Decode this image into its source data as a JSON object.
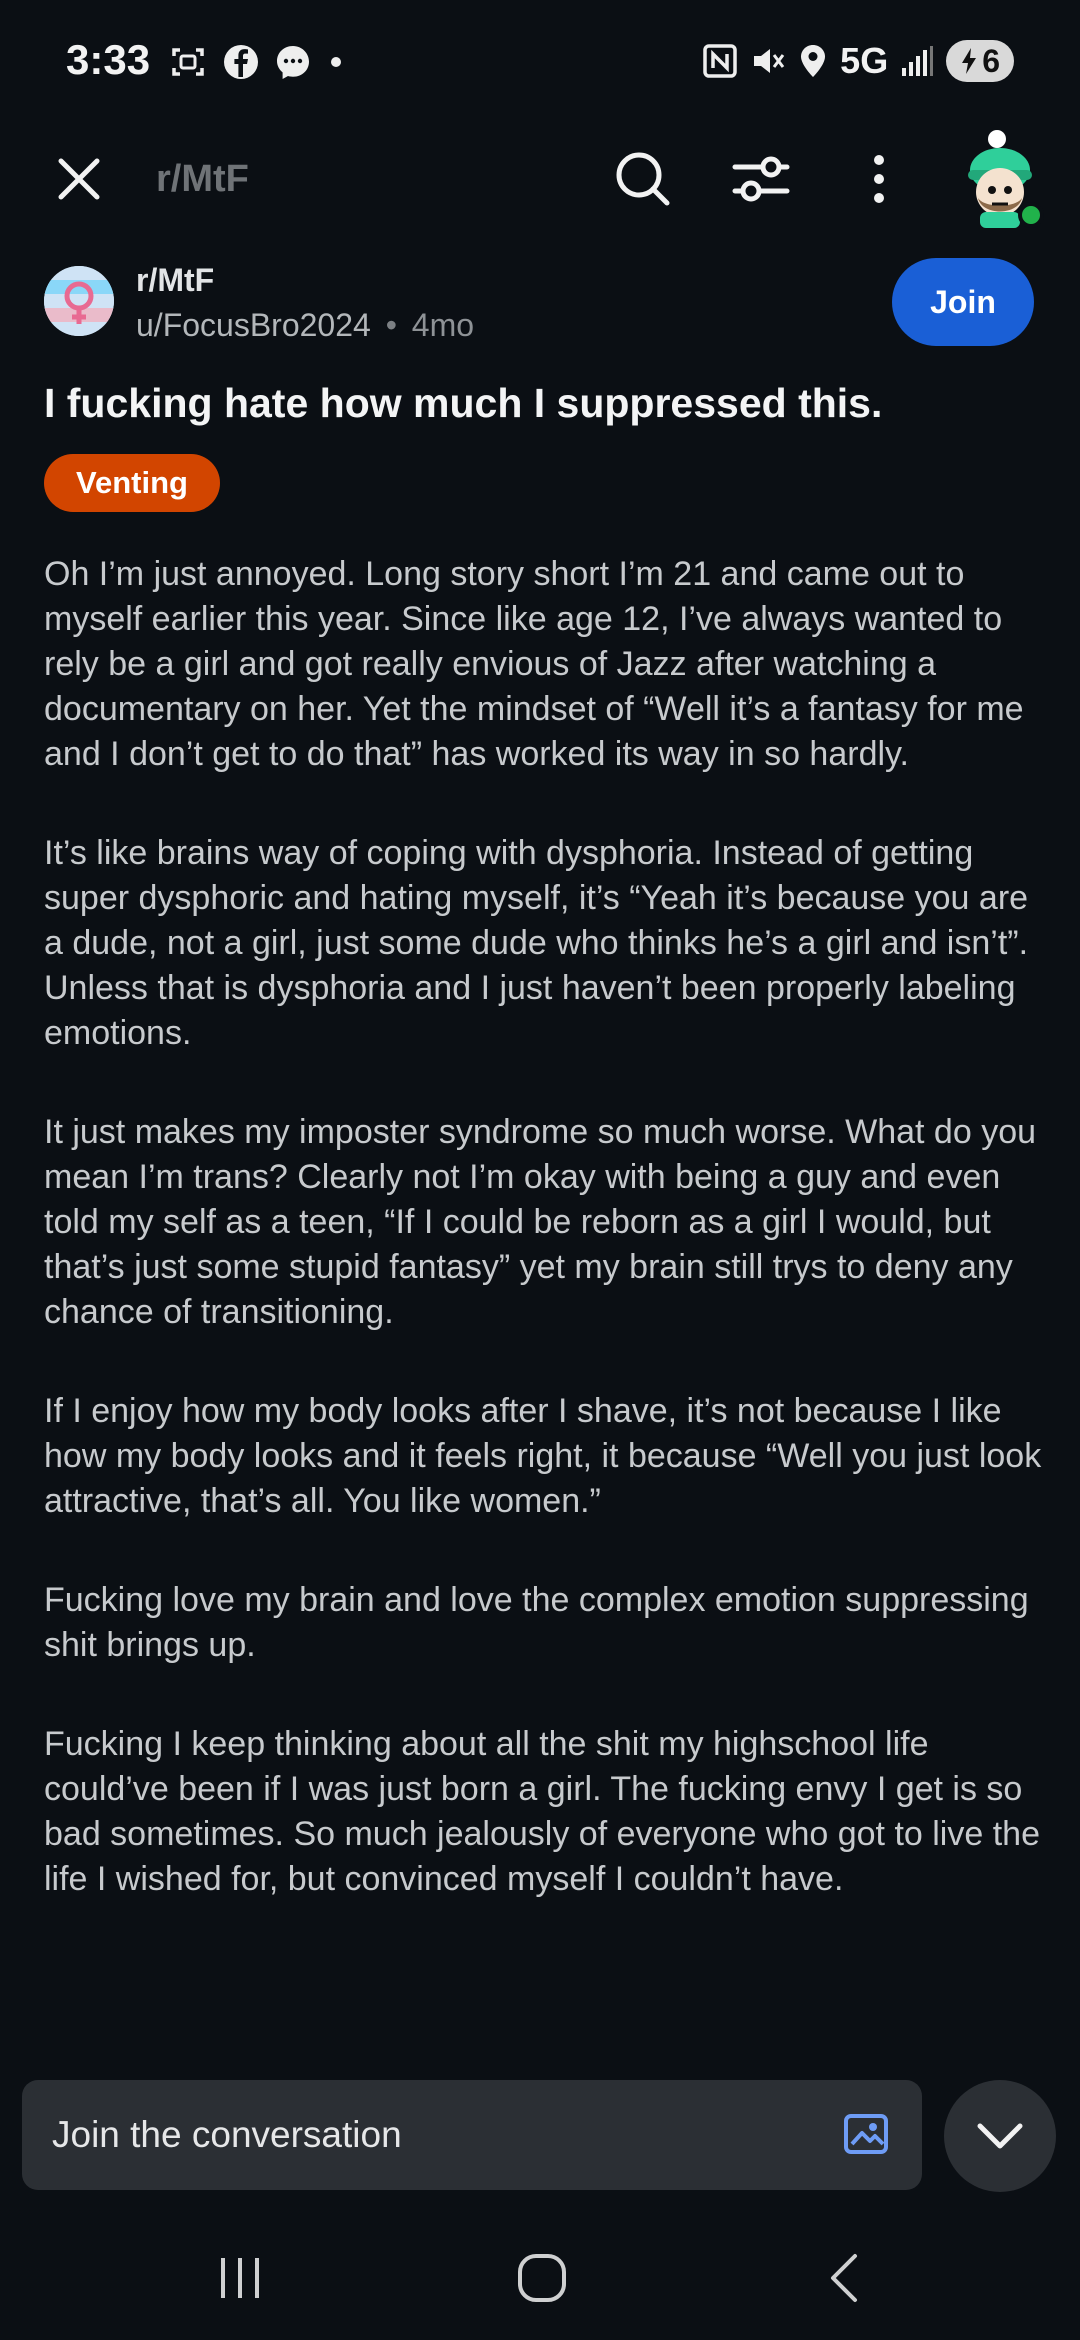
{
  "status_bar": {
    "time": "3:33",
    "network": "5G",
    "battery": "6",
    "icons": [
      "screenshot-icon",
      "facebook-icon",
      "messenger-icon",
      "dot-icon",
      "nfc-icon",
      "mute-icon",
      "location-icon",
      "signal-icon",
      "battery-charging-icon"
    ]
  },
  "nav": {
    "title": "r/MtF",
    "icons": [
      "close-icon",
      "search-icon",
      "filter-icon",
      "more-icon",
      "avatar"
    ]
  },
  "post": {
    "subreddit": "r/MtF",
    "author": "u/FocusBro2024",
    "separator": "•",
    "age": "4mo",
    "join_label": "Join",
    "title": "I fucking hate how much I suppressed this.",
    "flair": "Venting",
    "flair_color": "#d24500",
    "body": [
      "Oh I’m just annoyed. Long story short I’m 21 and came out to myself earlier this year. Since like age 12, I’ve always wanted to rely be a girl and got really envious of Jazz after watching a documentary on her. Yet the mindset of “Well it’s a fantasy for me and I don’t get to do that” has worked its way in so hardly.",
      "It’s like brains way of coping with dysphoria. Instead of getting super dysphoric and hating myself, it’s “Yeah it’s because you are a dude, not a girl, just some dude who thinks he’s a girl and isn’t”. Unless that is dysphoria and I just haven’t been properly labeling emotions.",
      "It just makes my imposter syndrome so much worse. What do you mean I’m trans? Clearly not I’m okay with being a guy and even told my self as a teen, “If I could be reborn as a girl I would, but that’s just some stupid fantasy” yet my brain still trys to deny any chance of transitioning.",
      "If I enjoy how my body looks after I shave, it’s not because I like how my body looks and it feels right, it because “Well you just look attractive, that’s all. You like women.”",
      "Fucking love my brain and love the complex emotion suppressing shit brings up.",
      "Fucking I keep thinking about all the shit my highschool life could’ve been if I was just born a girl. The fucking envy I get is so bad sometimes. So much jealously of everyone who got to live the life I wished for, but convinced myself I couldn’t have."
    ]
  },
  "composer": {
    "placeholder": "Join the conversation",
    "icons": [
      "image-icon",
      "chevron-down-icon"
    ]
  },
  "android_nav": {
    "icons": [
      "recents-icon",
      "home-icon",
      "back-icon"
    ]
  },
  "colors": {
    "background": "#0b0f14",
    "join_button": "#1a5fd6",
    "composer_bg": "#2b2f34",
    "online_dot": "#21b24b"
  }
}
